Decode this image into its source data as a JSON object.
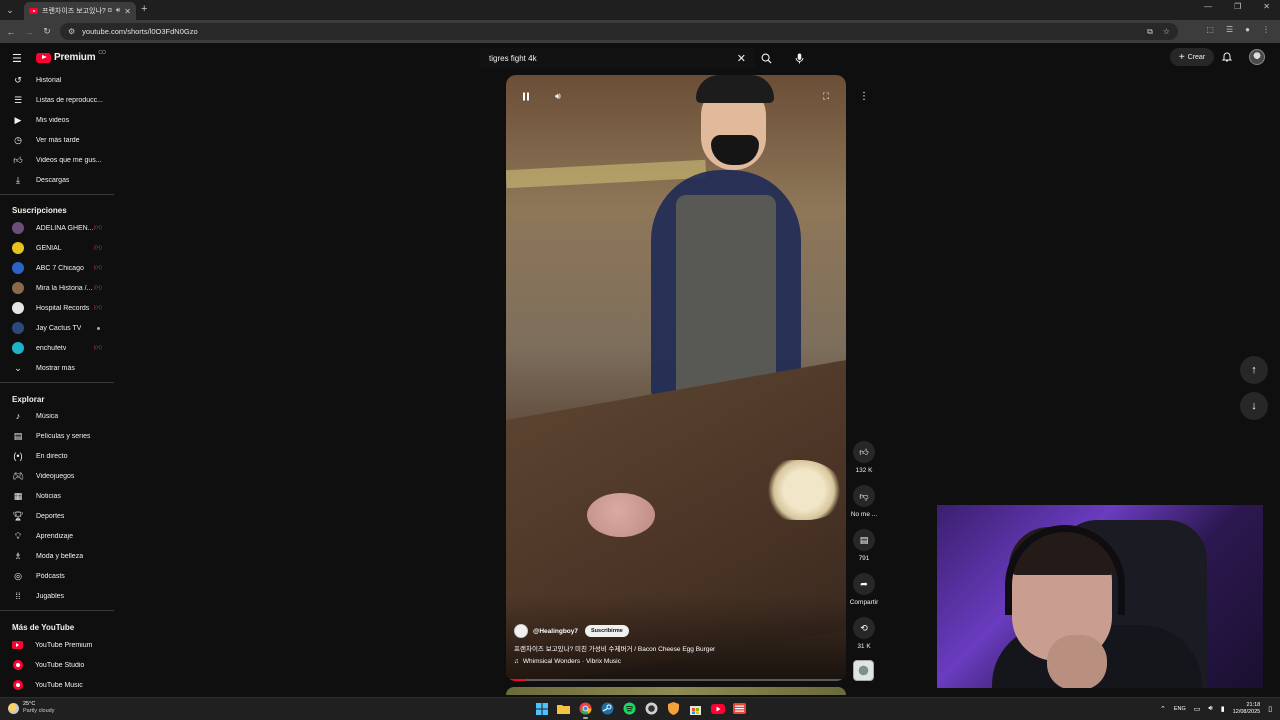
{
  "browser": {
    "tab_title": "프랜차이즈 보고있나? 미친",
    "url": "youtube.com/shorts/l0O3FdN0Gzo"
  },
  "masthead": {
    "logo_text": "Premium",
    "logo_superscript": "CO",
    "search_value": "tigres fight  4k",
    "create_label": "Crear"
  },
  "sidebar": {
    "you_items": [
      {
        "label": "Historial",
        "icon": "history-icon"
      },
      {
        "label": "Listas de reproducc...",
        "icon": "playlists-icon"
      },
      {
        "label": "Mis videos",
        "icon": "my-videos-icon"
      },
      {
        "label": "Ver más tarde",
        "icon": "watch-later-icon"
      },
      {
        "label": "Videos que me gus...",
        "icon": "liked-videos-icon"
      },
      {
        "label": "Descargas",
        "icon": "downloads-icon"
      }
    ],
    "subscriptions_heading": "Suscripciones",
    "subscriptions": [
      {
        "label": "ADELINA GHEN...",
        "color": "#6b4f7a",
        "indicator": "live"
      },
      {
        "label": "GENIAL",
        "color": "#e8c31e",
        "indicator": "live"
      },
      {
        "label": "ABC 7 Chicago",
        "color": "#2d63c8",
        "indicator": "live"
      },
      {
        "label": "Mira la Historia /...",
        "color": "#8a6a4a",
        "indicator": "live"
      },
      {
        "label": "Hospital Records",
        "color": "#e6e6e6",
        "indicator": "live"
      },
      {
        "label": "Jay Cactus TV",
        "color": "#2b4a7a",
        "indicator": "dot"
      },
      {
        "label": "enchufetv",
        "color": "#1fb3c9",
        "indicator": "live"
      }
    ],
    "show_more_label": "Mostrar más",
    "explore_heading": "Explorar",
    "explore_items": [
      {
        "label": "Música",
        "icon": "music-icon"
      },
      {
        "label": "Películas y series",
        "icon": "movies-icon"
      },
      {
        "label": "En directo",
        "icon": "live-icon"
      },
      {
        "label": "Videojuegos",
        "icon": "gaming-icon"
      },
      {
        "label": "Noticias",
        "icon": "news-icon"
      },
      {
        "label": "Deportes",
        "icon": "sports-icon"
      },
      {
        "label": "Aprendizaje",
        "icon": "learning-icon"
      },
      {
        "label": "Moda y belleza",
        "icon": "fashion-icon"
      },
      {
        "label": "Pódcasts",
        "icon": "podcasts-icon"
      },
      {
        "label": "Jugables",
        "icon": "playables-icon"
      }
    ],
    "more_heading": "Más de YouTube",
    "more_items": [
      {
        "label": "YouTube Premium",
        "icon": "youtube-premium-icon"
      },
      {
        "label": "YouTube Studio",
        "icon": "youtube-studio-icon"
      },
      {
        "label": "YouTube Music",
        "icon": "youtube-music-icon"
      }
    ]
  },
  "short": {
    "channel": "@Healingboy7",
    "subscribe_label": "Suscribirme",
    "title": "프랜차이즈 보고있나? 미친 가성비 수제버거 / Bacon Cheese Egg Burger",
    "music": "Whimsical Wonders · Vibrix Music",
    "progress": 0.06
  },
  "actions": {
    "likes": "132 K",
    "dislike_label": "No me ...",
    "comments": "791",
    "share_label": "Compartir",
    "remix_count": "31 K"
  },
  "taskbar": {
    "temperature": "25°C",
    "weather": "Partly cloudy",
    "language": "ENG",
    "time": "21:18",
    "date": "12/08/2025",
    "apps": [
      {
        "icon": "windows-start-icon",
        "color": "#4cc2ff"
      },
      {
        "icon": "file-explorer-icon",
        "color": "#f5c242"
      },
      {
        "icon": "chrome-icon",
        "color": "#e8453c"
      },
      {
        "icon": "steam-icon",
        "color": "#1b6fa8"
      },
      {
        "icon": "spotify-icon",
        "color": "#1ed760"
      },
      {
        "icon": "obs-icon",
        "color": "#d0d0d0"
      },
      {
        "icon": "bitdefender-icon",
        "color": "#f4a23c"
      },
      {
        "icon": "store-icon",
        "color": "#e6e6e6"
      },
      {
        "icon": "youtube-app-icon",
        "color": "#ff0033"
      },
      {
        "icon": "recorder-icon",
        "color": "#e8453c"
      }
    ]
  }
}
